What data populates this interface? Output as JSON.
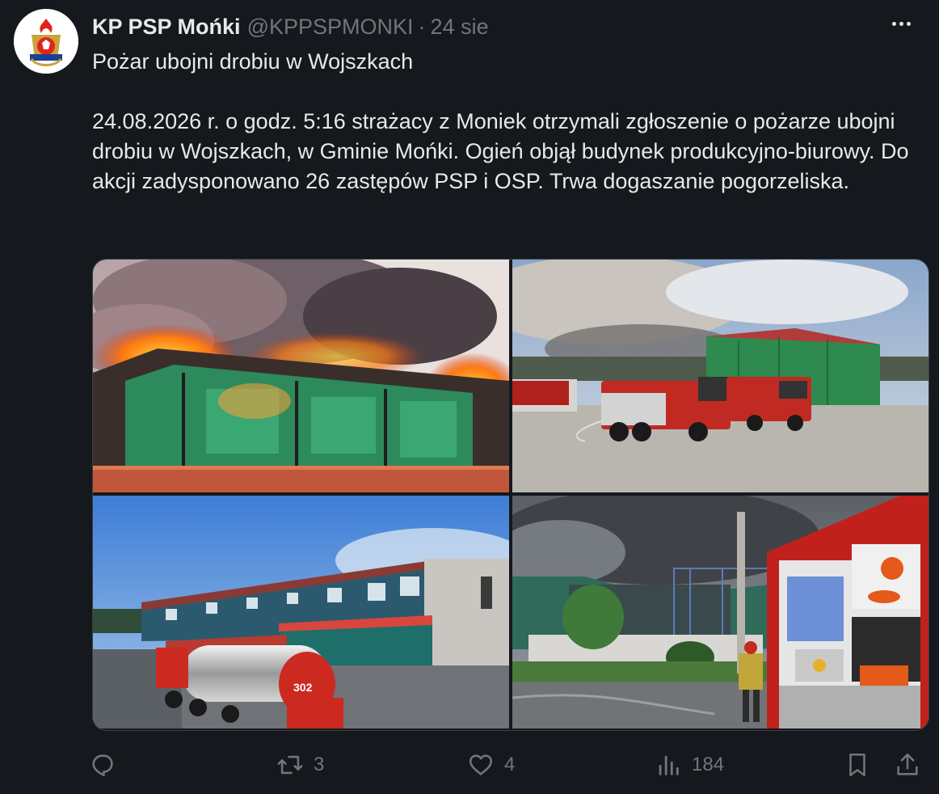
{
  "tweet": {
    "author_name": "KP PSP Mońki",
    "handle": "@KPPSPMONKI",
    "separator": "·",
    "time": "24 sie",
    "text": "Pożar ubojni drobiu w Wojszkach\n\n24.08.2026 r. o godz. 5:16 strażacy z Moniek otrzymali zgłoszenie o pożarze ubojni drobiu w Wojszkach, w Gminie Mońki. Ogień objął budynek produkcyjno-biurowy. Do akcji zadysponowano 26 zastępów PSP i OSP. Trwa dogaszanie pogorzeliska."
  },
  "media": {
    "photos": [
      {
        "subject": "burning-building"
      },
      {
        "subject": "fire-trucks-at-warehouse"
      },
      {
        "subject": "tanker-truck-and-building"
      },
      {
        "subject": "burned-hall-and-firefighter"
      }
    ],
    "truck_plate": "302"
  },
  "actions": {
    "replies": "",
    "retweets": "3",
    "likes": "4",
    "views": "184"
  },
  "icons": {
    "reply": "reply-icon",
    "retweet": "retweet-icon",
    "like": "heart-icon",
    "views": "views-icon",
    "bookmark": "bookmark-icon",
    "share": "share-icon",
    "more": "more-icon"
  },
  "colors": {
    "background": "#15181c",
    "text": "#e7e9ea",
    "muted": "#71767b"
  }
}
